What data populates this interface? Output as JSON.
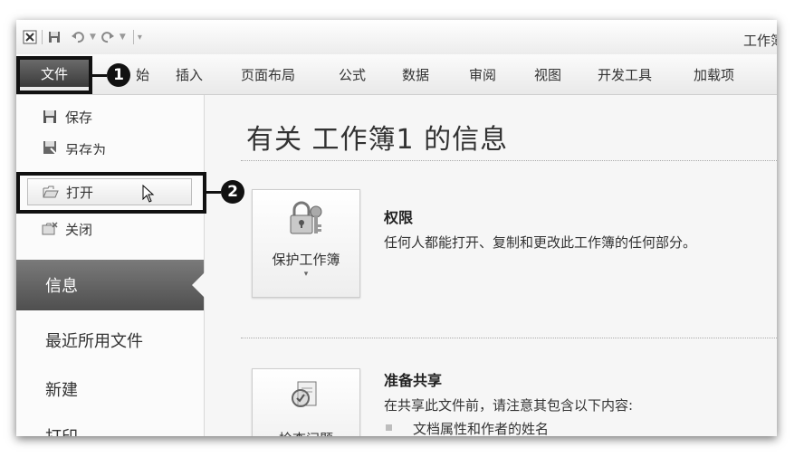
{
  "window": {
    "title": "工作簿"
  },
  "ribbon": {
    "file_tab": "文件",
    "tabs": [
      "插入",
      "页面布局",
      "公式",
      "数据",
      "审阅",
      "视图",
      "开发工具",
      "加载项"
    ],
    "partial_tab": "始"
  },
  "callouts": {
    "one": "1",
    "two": "2"
  },
  "backstage": {
    "commands": [
      {
        "label": "保存",
        "icon": "save-icon"
      },
      {
        "label": "另存为",
        "icon": "save-as-icon"
      },
      {
        "label": "打开",
        "icon": "open-folder-icon"
      },
      {
        "label": "关闭",
        "icon": "close-folder-icon"
      }
    ],
    "selected": "信息",
    "nav": [
      "最近所用文件",
      "新建",
      "打印"
    ]
  },
  "info": {
    "title": "有关 工作簿1 的信息",
    "permissions": {
      "button_label": "保护工作簿",
      "title": "权限",
      "desc": "任何人都能打开、复制和更改此工作簿的任何部分。"
    },
    "prepare": {
      "button_label": "检查问题",
      "title": "准备共享",
      "desc": "在共享此文件前，请注意其包含以下内容:",
      "items": [
        "文档属性和作者的姓名"
      ]
    }
  }
}
